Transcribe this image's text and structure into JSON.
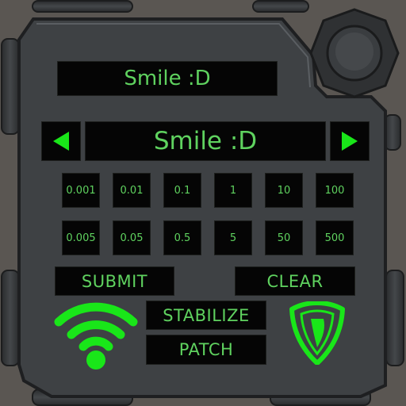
{
  "display": {
    "top_text": "Smile :D",
    "selector_text": "Smile :D"
  },
  "selector": {
    "left_arrow_icon": "triangle-left-icon",
    "right_arrow_icon": "triangle-right-icon"
  },
  "increments": {
    "row1": [
      "0.001",
      "0.01",
      "0.1",
      "1",
      "10",
      "100"
    ],
    "row2": [
      "0.005",
      "0.05",
      "0.5",
      "5",
      "50",
      "500"
    ]
  },
  "buttons": {
    "submit": "SUBMIT",
    "clear": "CLEAR",
    "stabilize": "STABILIZE",
    "patch": "PATCH"
  },
  "icons": {
    "signal": "wifi-signal-icon",
    "shield": "shield-icon",
    "knob": "round-knob-icon"
  },
  "colors": {
    "text_green": "#5fd25f",
    "icon_green": "#19e619",
    "panel": "#3e4144",
    "screen": "#050505",
    "background": "#5a5652"
  }
}
